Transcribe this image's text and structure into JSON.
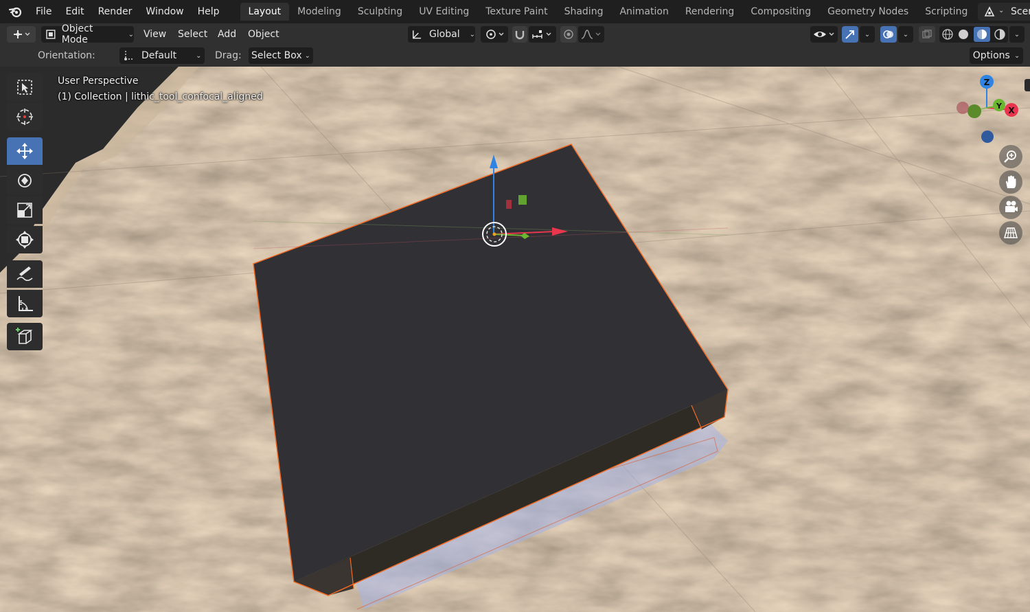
{
  "topbar": {
    "menus": [
      "File",
      "Edit",
      "Render",
      "Window",
      "Help"
    ],
    "workspaces": [
      "Layout",
      "Modeling",
      "Sculpting",
      "UV Editing",
      "Texture Paint",
      "Shading",
      "Animation",
      "Rendering",
      "Compositing",
      "Geometry Nodes",
      "Scripting"
    ],
    "active_workspace": "Layout",
    "add_workspace": "+",
    "scene_label": "Scene"
  },
  "header": {
    "mode": "Object Mode",
    "menus": [
      "View",
      "Select",
      "Add",
      "Object"
    ],
    "transform_orientation": "Global"
  },
  "tool_settings": {
    "orientation_label": "Orientation:",
    "orientation_value": "Default",
    "drag_label": "Drag:",
    "drag_value": "Select Box",
    "options_label": "Options"
  },
  "viewport": {
    "view_name": "User Perspective",
    "collection_info": "(1) Collection | lithic_tool_confocal_aligned",
    "axis_labels": {
      "z": "Z",
      "y": "Y",
      "x": "X"
    },
    "colors": {
      "x_axis": "#e8364f",
      "y_axis": "#6bb630",
      "z_axis": "#2f83e3",
      "selection_outline": "#f06a26",
      "active_blue": "#4772b3"
    }
  },
  "toolbar": {
    "tools": [
      "select-box",
      "cursor",
      "move",
      "rotate",
      "scale",
      "transform",
      "annotate",
      "measure",
      "add-cube"
    ],
    "active_tool": "move"
  },
  "icons": [
    "blender-logo-icon",
    "select-box-icon",
    "cursor-icon",
    "move-icon",
    "rotate-icon",
    "scale-icon",
    "transform-icon",
    "annotate-icon",
    "measure-icon",
    "add-cube-icon",
    "zoom-icon",
    "hand-icon",
    "camera-icon",
    "grid-icon"
  ]
}
